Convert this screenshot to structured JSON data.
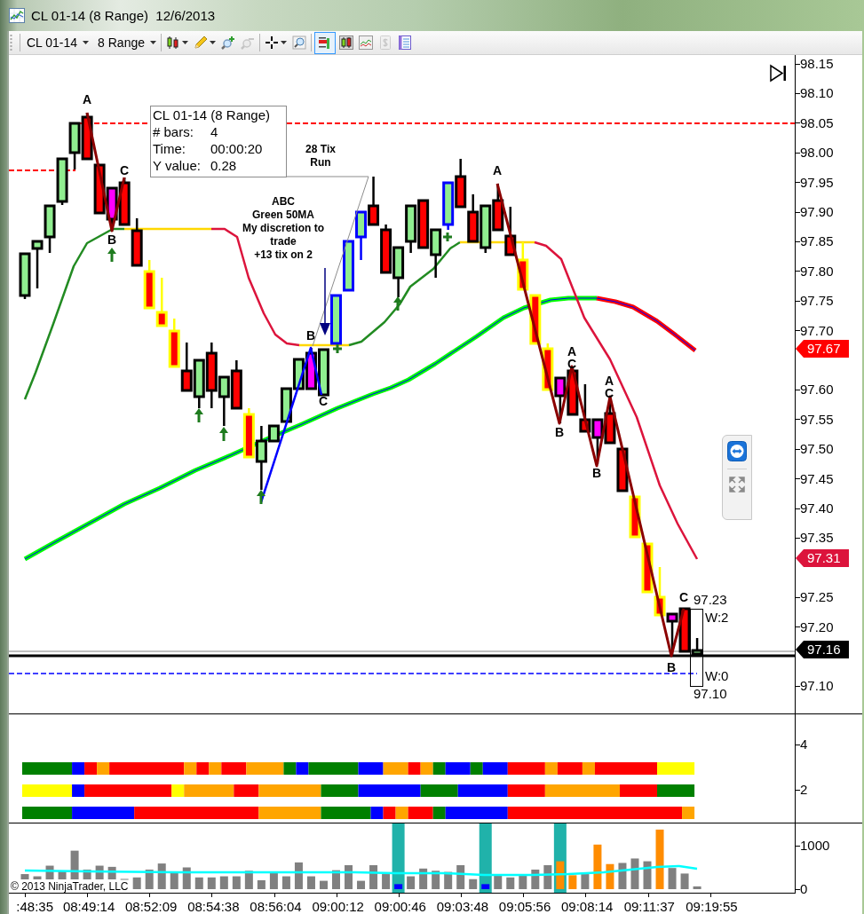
{
  "window": {
    "title": "CL 01-14 (8 Range)  12/6/2013"
  },
  "toolbar": {
    "instrument": "CL 01-14",
    "interval": "8 Range",
    "tool_groups": [
      [
        {
          "kind": "candles",
          "menu": true,
          "selected": false,
          "disabled": false
        },
        {
          "kind": "pencil",
          "menu": true,
          "selected": false,
          "disabled": false
        },
        {
          "kind": "zoom-in",
          "menu": false,
          "selected": false,
          "disabled": false
        },
        {
          "kind": "zoom-out",
          "menu": false,
          "selected": false,
          "disabled": true
        }
      ],
      [
        {
          "kind": "crosshair",
          "menu": true,
          "selected": false,
          "disabled": false
        },
        {
          "kind": "magnifier",
          "menu": false,
          "selected": false,
          "disabled": false
        }
      ],
      [
        {
          "kind": "bars",
          "menu": false,
          "selected": true,
          "disabled": false
        },
        {
          "kind": "candle-box",
          "menu": false,
          "selected": false,
          "disabled": false
        },
        {
          "kind": "line-chart",
          "menu": false,
          "selected": false,
          "disabled": false
        },
        {
          "kind": "dollar",
          "menu": false,
          "selected": false,
          "disabled": true
        },
        {
          "kind": "panel",
          "menu": false,
          "selected": false,
          "disabled": false
        }
      ]
    ]
  },
  "price_panel": {
    "tooltip": {
      "title": "CL 01-14 (8 Range)",
      "rows": [
        {
          "label": "# bars:",
          "value": "4"
        },
        {
          "label": "Time:",
          "value": "00:00:20"
        },
        {
          "label": "Y value:",
          "value": "0.28"
        }
      ]
    },
    "notes": [
      "28 Tix\nRun",
      "ABC\nGreen 50MA\nMy discretion to\ntrade\n+13 tix on 2"
    ],
    "pattern_labels": [
      "A",
      "B",
      "C",
      "B",
      "C",
      "A",
      "B",
      "A",
      "C",
      "B",
      "A",
      "C",
      "B",
      "C"
    ],
    "measure_labels": [
      "97.23",
      "W:2",
      "W:0",
      "97.10"
    ],
    "axis_labels": [
      "98.15",
      "98.10",
      "98.05",
      "98.00",
      "97.95",
      "97.90",
      "97.85",
      "97.80",
      "97.75",
      "97.70",
      "97.60",
      "97.55",
      "97.50",
      "97.45",
      "97.40",
      "97.35",
      "97.25",
      "97.20",
      "97.10"
    ],
    "price_markers": [
      {
        "text": "97.67",
        "color": "#ff0000"
      },
      {
        "text": "97.31",
        "color": "#dc143c"
      },
      {
        "text": "97.16",
        "color": "#000000"
      }
    ]
  },
  "indicator_panel": {
    "axis_labels": [
      "4",
      "2"
    ]
  },
  "volume_panel": {
    "copyright": "© 2013 NinjaTrader, LLC",
    "axis_labels": [
      "1000",
      "0"
    ]
  },
  "time_axis": {
    "labels": [
      ":48:35",
      "08:49:14",
      "08:52:09",
      "08:54:38",
      "08:56:04",
      "09:00:12",
      "09:00:46",
      "09:03:48",
      "09:05:56",
      "09:08:14",
      "09:11:37",
      "09:19:55"
    ]
  }
}
